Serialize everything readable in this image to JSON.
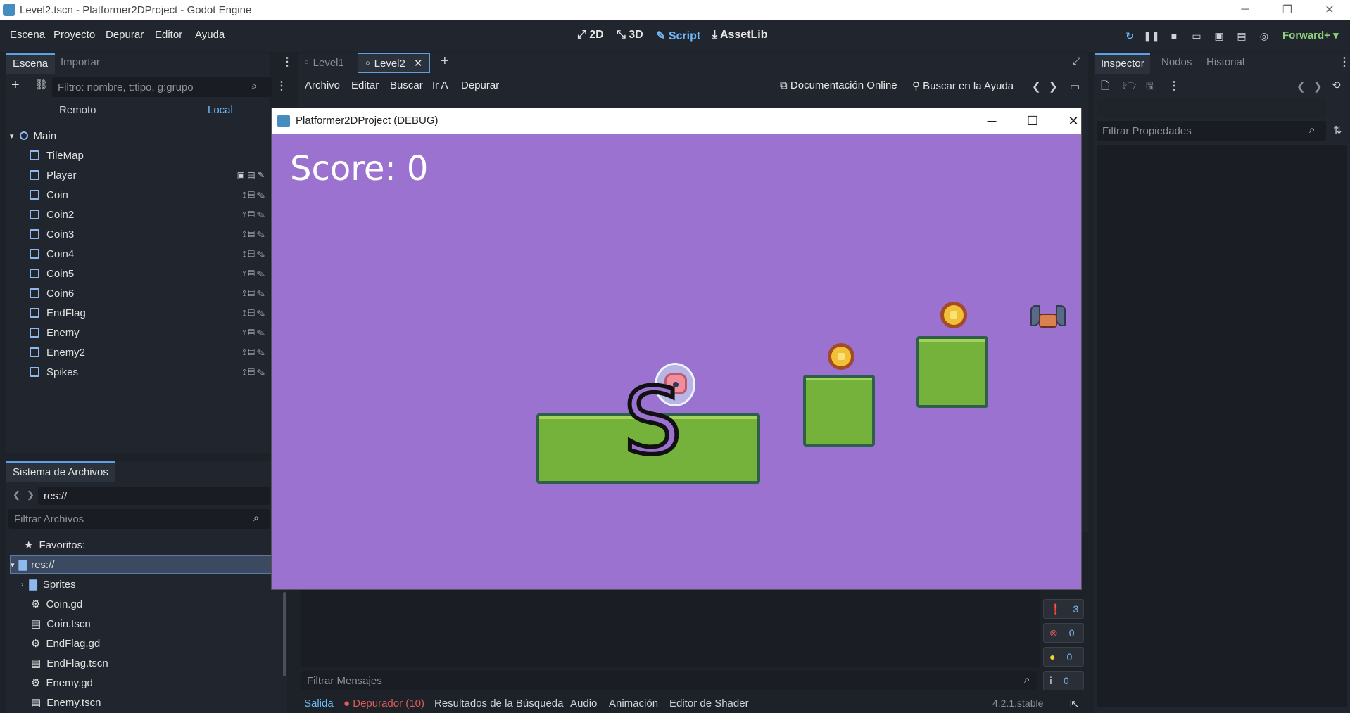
{
  "os": {
    "title": "Level2.tscn - Platformer2DProject - Godot Engine",
    "minimize": "─",
    "restore": "❐",
    "close": "✕"
  },
  "menu": {
    "items": [
      "Escena",
      "Proyecto",
      "Depurar",
      "Editor",
      "Ayuda"
    ],
    "workspaces": [
      "2D",
      "3D",
      "Script",
      "AssetLib"
    ],
    "active_workspace": "Script",
    "renderer": "Forward+"
  },
  "scene_dock": {
    "tabs": [
      "Escena",
      "Importar"
    ],
    "filter_placeholder": "Filtro: nombre, t:tipo, g:grupo",
    "remote_label": "Remoto",
    "local_label": "Local",
    "root": "Main",
    "nodes": [
      "TileMap",
      "Player",
      "Coin",
      "Coin2",
      "Coin3",
      "Coin4",
      "Coin5",
      "Coin6",
      "EndFlag",
      "Enemy",
      "Enemy2",
      "Spikes"
    ]
  },
  "filesystem": {
    "tab": "Sistema de Archivos",
    "path": "res://",
    "filter_placeholder": "Filtrar Archivos",
    "favorites": "Favoritos:",
    "root": "res://",
    "items": [
      "Sprites",
      "Coin.gd",
      "Coin.tscn",
      "EndFlag.gd",
      "EndFlag.tscn",
      "Enemy.gd",
      "Enemy.tscn"
    ]
  },
  "editor": {
    "tabs": [
      "Level1",
      "Level2"
    ],
    "active_tab": "Level2",
    "script_menu": [
      "Archivo",
      "Editar",
      "Buscar",
      "Ir A",
      "Depurar"
    ],
    "online_docs": "Documentación Online",
    "search_help": "Buscar en la Ayuda"
  },
  "game": {
    "window_title": "Platformer2DProject (DEBUG)",
    "score_text": "Score: 0",
    "s_glyph": "S"
  },
  "inspector": {
    "tabs": [
      "Inspector",
      "Nodos",
      "Historial"
    ],
    "filter_placeholder": "Filtrar Propiedades"
  },
  "bottom": {
    "filter_placeholder": "Filtrar Mensajes",
    "tabs": [
      "Salida",
      "Depurador (10)",
      "Resultados de la Búsqueda",
      "Audio",
      "Animación",
      "Editor de Shader"
    ],
    "version": "4.2.1.stable",
    "counters": [
      "3",
      "0",
      "0",
      "0"
    ]
  },
  "colors": {
    "accent": "#70bafa",
    "game_bg": "#9b72d0",
    "error": "#e05a5a",
    "warning": "#f2d03b"
  }
}
